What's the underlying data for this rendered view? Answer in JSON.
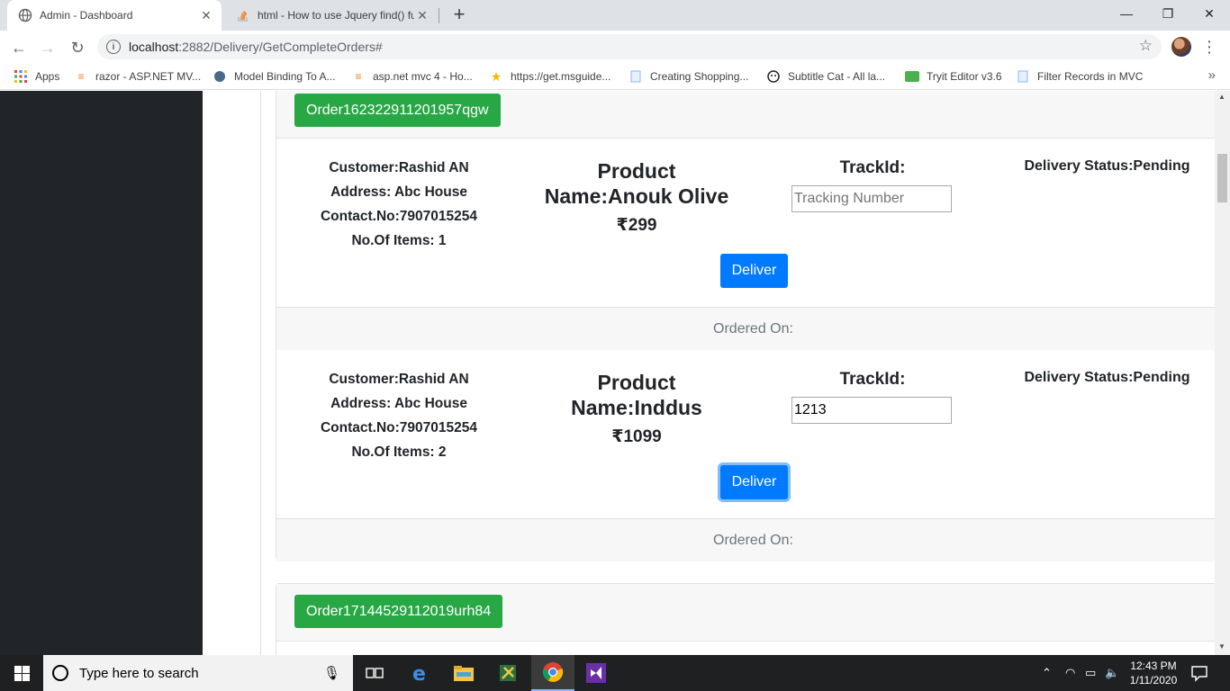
{
  "browser": {
    "tabs": [
      {
        "title": "Admin - Dashboard",
        "close": "✕"
      },
      {
        "title": "html - How to use Jquery find() fu",
        "close": "✕"
      }
    ],
    "new_tab": "+",
    "window": {
      "minimize": "—",
      "maximize": "❐",
      "close": "✕"
    },
    "nav": {
      "back": "←",
      "forward": "→",
      "reload": "↻"
    },
    "address": {
      "host": "localhost",
      "rest": ":2882/Delivery/GetCompleteOrders#"
    },
    "bookmark_star": "☆",
    "menu": "⋮",
    "bookmarks": [
      {
        "label": "Apps"
      },
      {
        "label": "razor - ASP.NET MV..."
      },
      {
        "label": "Model Binding To A..."
      },
      {
        "label": "asp.net mvc 4 - Ho..."
      },
      {
        "label": "https://get.msguide..."
      },
      {
        "label": "Creating Shopping..."
      },
      {
        "label": "Subtitle Cat - All la..."
      },
      {
        "label": "Tryit Editor v3.6"
      },
      {
        "label": "Filter Records in MVC"
      }
    ],
    "bookmarks_more": "»"
  },
  "orders": [
    {
      "order_id": "Order162322911201957qgw",
      "items": [
        {
          "customer": "Customer:Rashid AN",
          "address": "Address: Abc House",
          "contact": "Contact.No:7907015254",
          "num_items": "No.Of Items: 1",
          "product_line1": "Product",
          "product_line2": "Name:Anouk Olive",
          "price": "₹299",
          "track_label": "TrackId:",
          "track_value": "",
          "track_placeholder": "Tracking Number",
          "status": "Delivery Status:Pending",
          "deliver_label": "Deliver",
          "ordered_on": "Ordered On:"
        },
        {
          "customer": "Customer:Rashid AN",
          "address": "Address: Abc House",
          "contact": "Contact.No:7907015254",
          "num_items": "No.Of Items: 2",
          "product_line1": "Product",
          "product_line2": "Name:Inddus",
          "price": "₹1099",
          "track_label": "TrackId:",
          "track_value": "1213",
          "track_placeholder": "Tracking Number",
          "status": "Delivery Status:Pending",
          "deliver_label": "Deliver",
          "ordered_on": "Ordered On:"
        }
      ]
    },
    {
      "order_id": "Order17144529112019urh84",
      "items": []
    }
  ],
  "taskbar": {
    "search_placeholder": "Type here to search",
    "time": "12:43 PM",
    "date": "1/11/2020"
  },
  "colors": {
    "sidebar": "#212529",
    "order_button": "#28a745",
    "deliver_button": "#007bff",
    "card_header": "#f7f7f7"
  }
}
